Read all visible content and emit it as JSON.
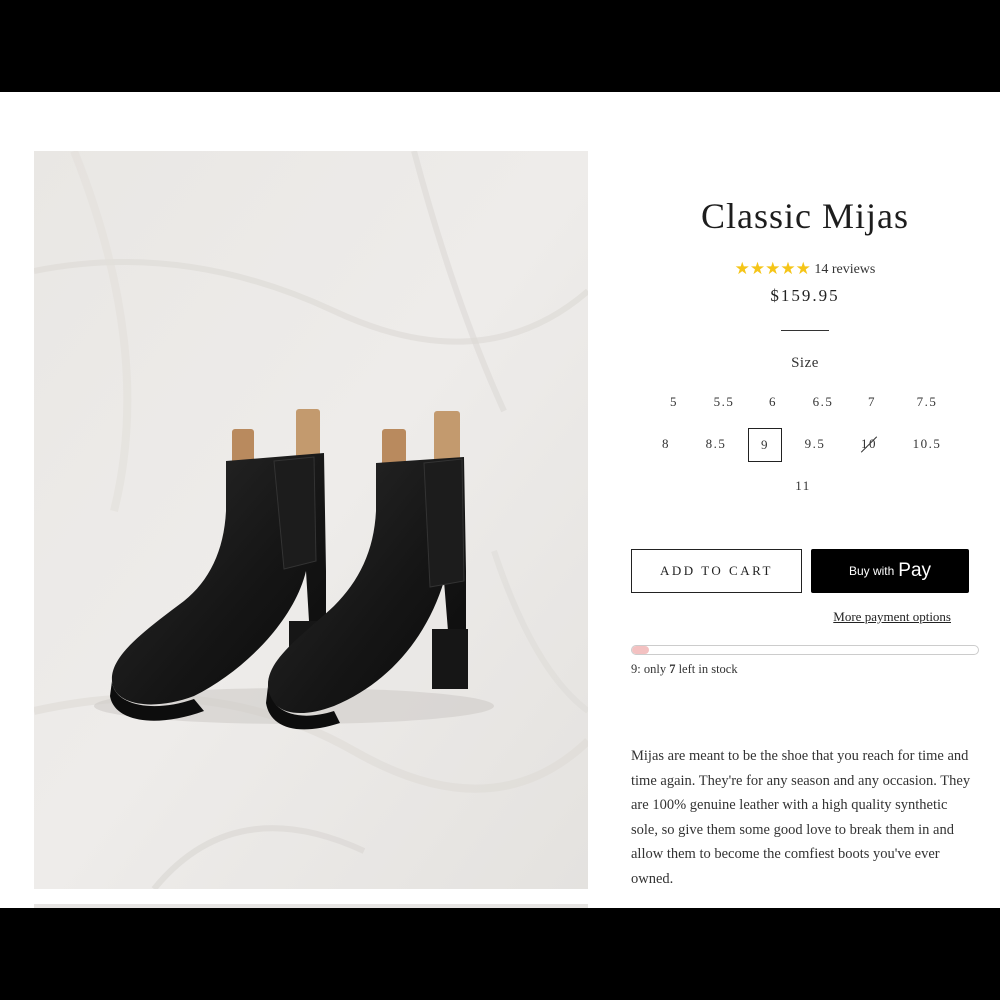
{
  "product": {
    "title": "Classic Mijas",
    "rating_stars": "★★★★★",
    "rating": 5,
    "reviews": "14 reviews",
    "price": "$159.95",
    "image_alt": "Pair of black leather Chelsea boots with tan mijas pull tabs"
  },
  "size": {
    "label": "Size",
    "options": [
      {
        "label": "5",
        "state": "available"
      },
      {
        "label": "5.5",
        "state": "available"
      },
      {
        "label": "6",
        "state": "available"
      },
      {
        "label": "6.5",
        "state": "available"
      },
      {
        "label": "7",
        "state": "available"
      },
      {
        "label": "7.5",
        "state": "available"
      },
      {
        "label": "8",
        "state": "available"
      },
      {
        "label": "8.5",
        "state": "available"
      },
      {
        "label": "9",
        "state": "selected"
      },
      {
        "label": "9.5",
        "state": "available"
      },
      {
        "label": "10",
        "state": "sold-out"
      },
      {
        "label": "10.5",
        "state": "available"
      },
      {
        "label": "11",
        "state": "available"
      }
    ]
  },
  "actions": {
    "add_to_cart": "ADD TO CART",
    "buy_with": "Buy with",
    "apple_glyph": "",
    "pay": "Pay",
    "more_payment": "More payment options"
  },
  "stock": {
    "size": "9",
    "prefix": ": only ",
    "count": "7",
    "suffix": " left in stock",
    "level": 0.05,
    "fill_color": "#f3c1c1"
  },
  "description": "Mijas are meant to be the shoe that you reach for time and time again. They're for any season and any occasion. They are 100% genuine leather with a high quality synthetic sole, so give them some good love to break them in and allow them to become the comfiest boots you've ever owned.",
  "colors": {
    "star": "#f5c518",
    "button_dark": "#000000",
    "text": "#222222"
  }
}
